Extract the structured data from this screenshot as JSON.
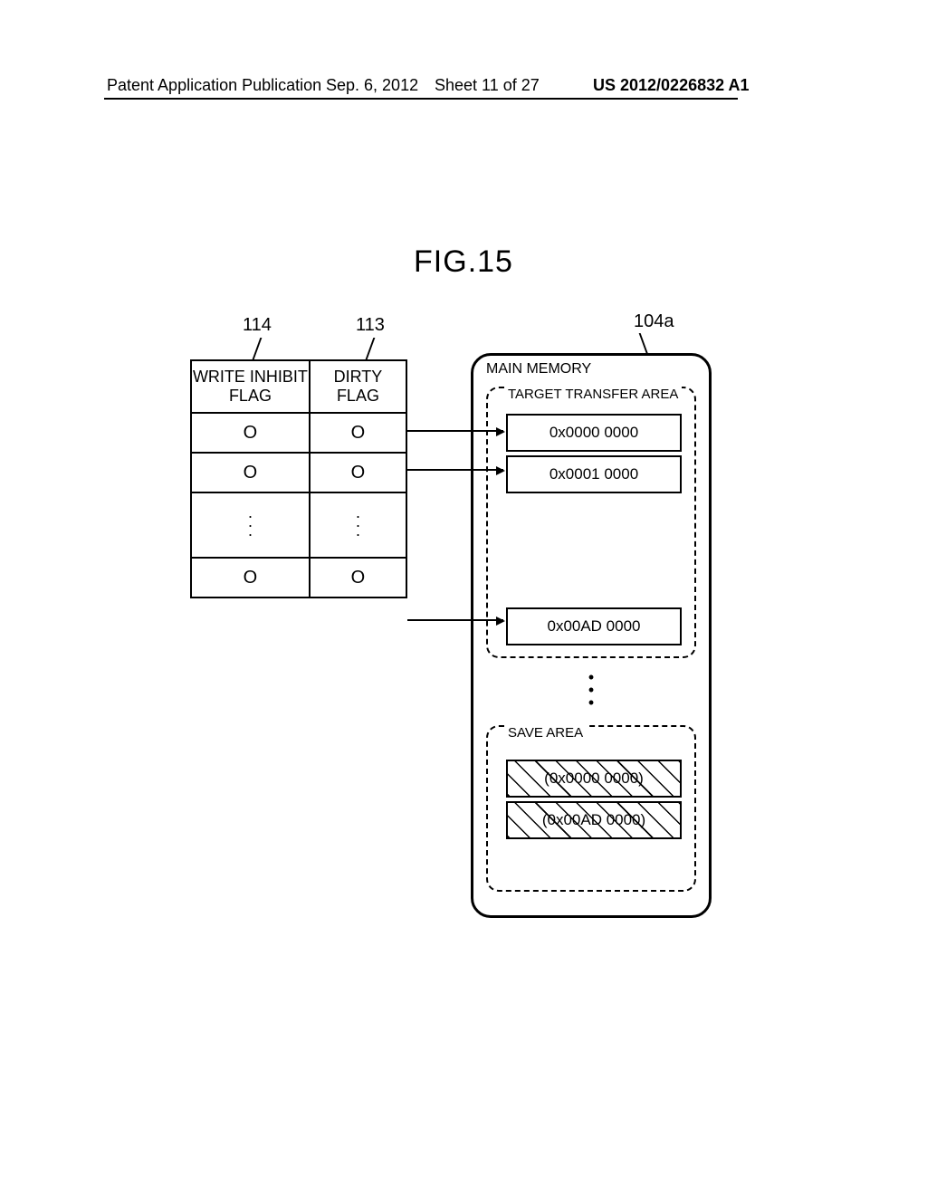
{
  "header": {
    "left": "Patent Application Publication",
    "date": "Sep. 6, 2012",
    "sheet": "Sheet 11 of 27",
    "pubno": "US 2012/0226832 A1"
  },
  "figure_title": "FIG.15",
  "refs": {
    "r114": "114",
    "r113": "113",
    "r104a": "104a"
  },
  "flag_table": {
    "col1": "WRITE INHIBIT FLAG",
    "col2": "DIRTY FLAG",
    "rows": [
      {
        "wif": "O",
        "df": "O"
      },
      {
        "wif": "O",
        "df": "O"
      },
      {
        "wif": "O",
        "df": "O"
      }
    ]
  },
  "main_memory": {
    "label": "MAIN MEMORY",
    "target_area_label": "TARGET TRANSFER AREA",
    "save_area_label": "SAVE AREA",
    "target_cells": [
      "0x0000 0000",
      "0x0001 0000",
      "0x00AD 0000"
    ],
    "save_cells": [
      "(0x0000 0000)",
      "(0x00AD 0000)"
    ]
  }
}
